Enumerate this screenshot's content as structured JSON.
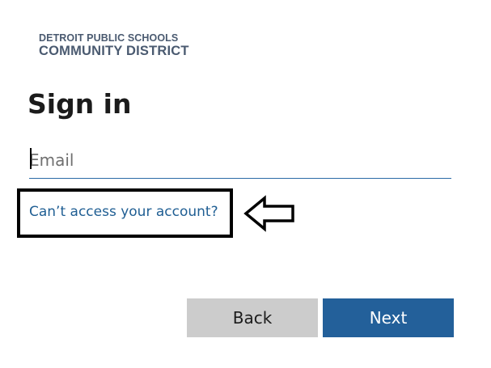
{
  "logo": {
    "line1": "DETROIT PUBLIC SCHOOLS",
    "line2": "COMMUNITY DISTRICT"
  },
  "signin": {
    "title": "Sign in",
    "email_placeholder": "Email",
    "email_value": "",
    "cant_access_link": "Can’t access your account?"
  },
  "buttons": {
    "back_label": "Back",
    "next_label": "Next"
  },
  "annotation": {
    "highlight_color": "#000000",
    "arrow_icon": "left-arrow-outline-icon"
  },
  "colors": {
    "link": "#1f5e93",
    "primary_button": "#23609a",
    "secondary_button": "#cccccc",
    "logo": "#4a5a70"
  }
}
